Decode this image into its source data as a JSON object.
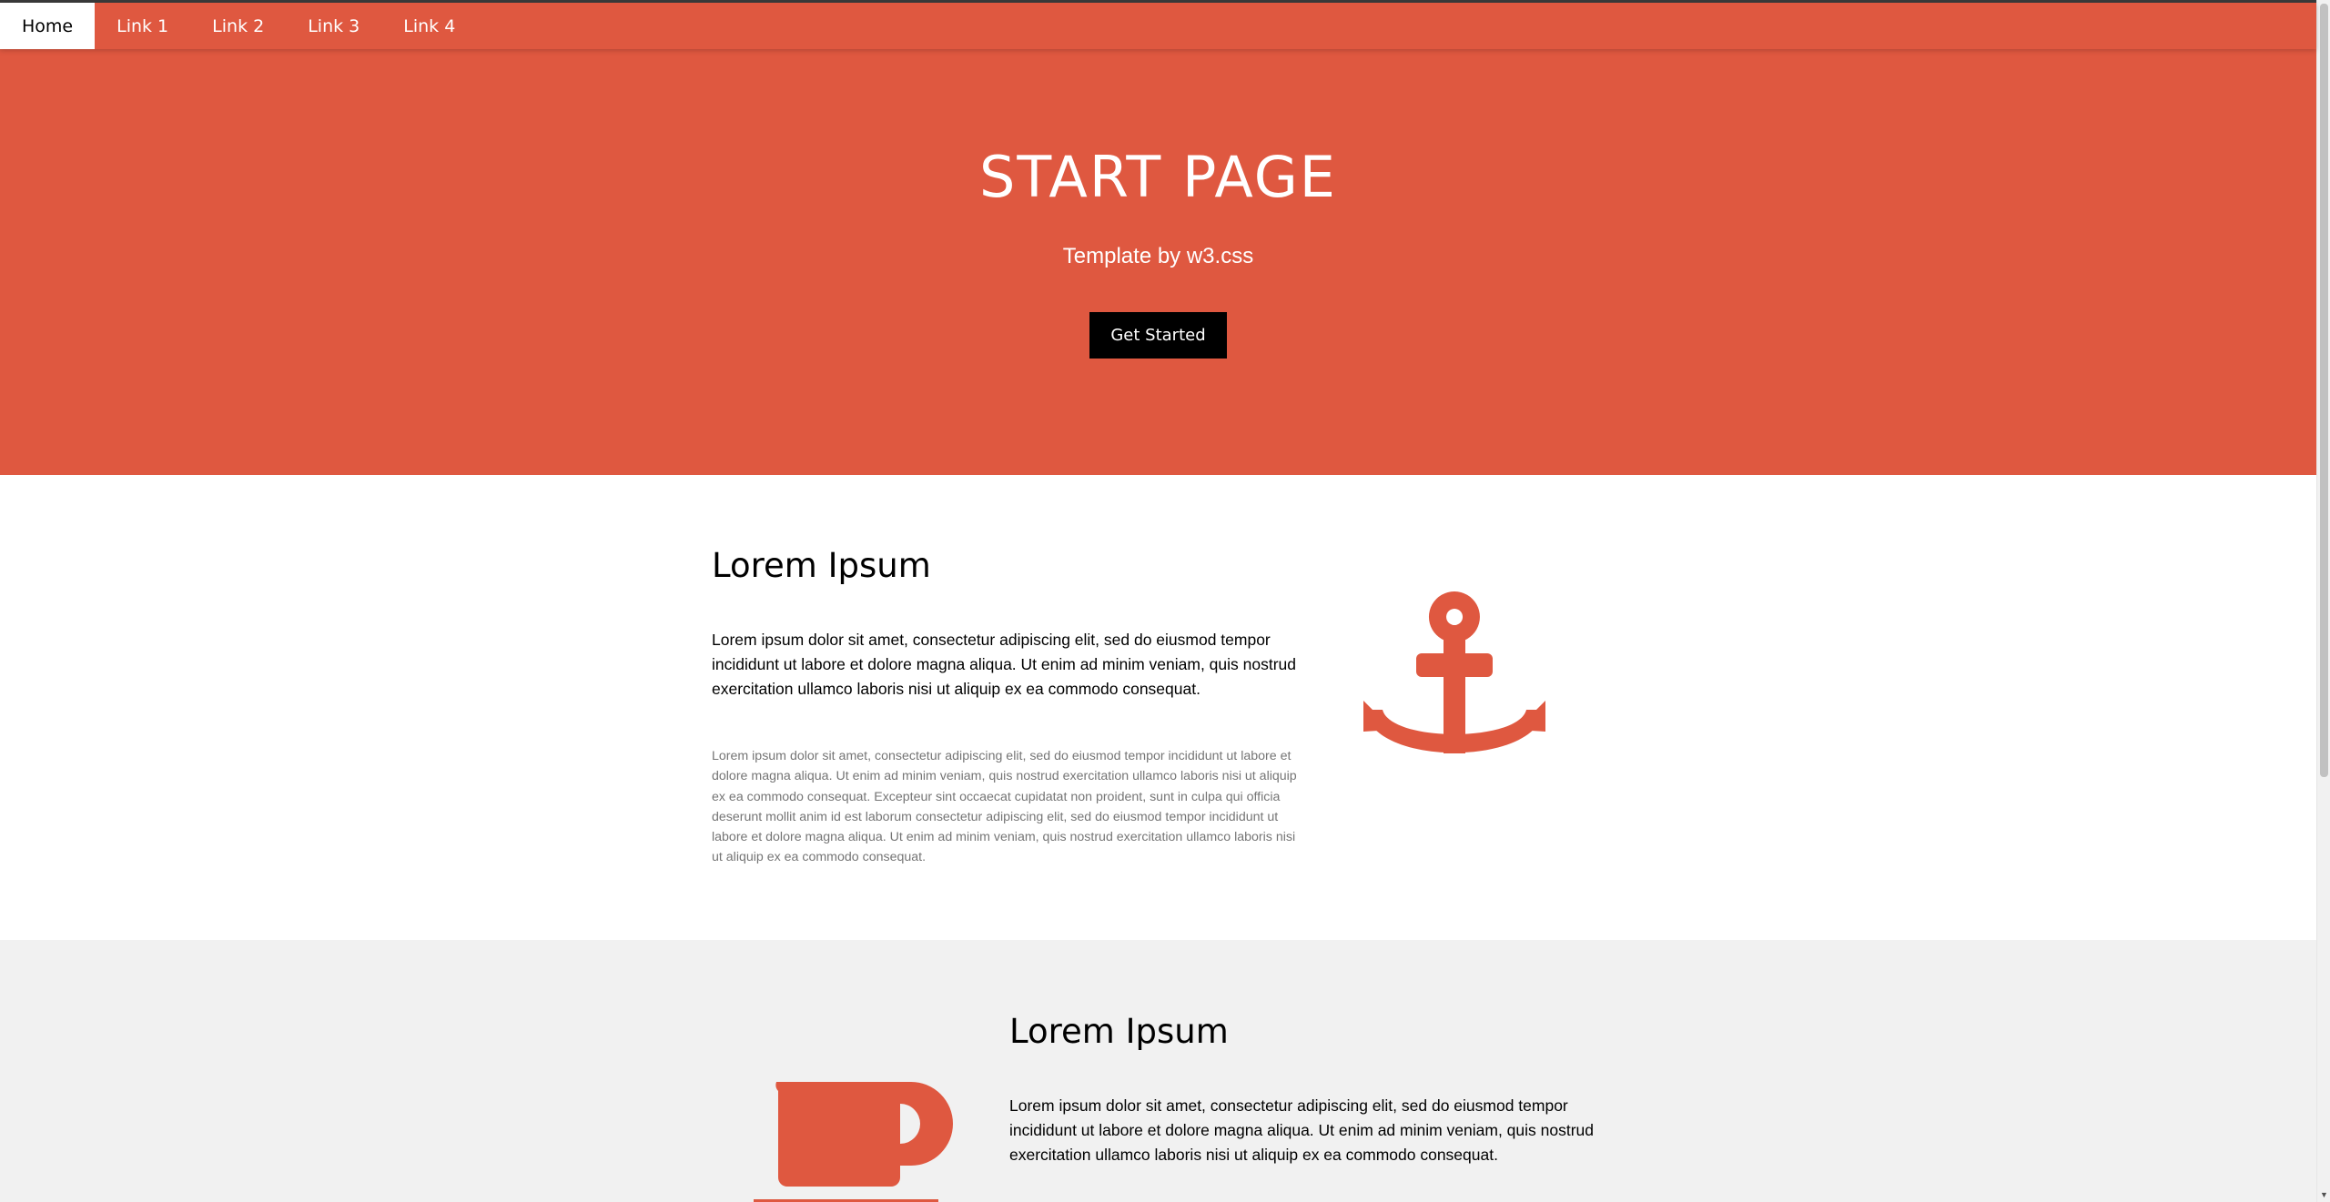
{
  "nav": {
    "items": [
      {
        "label": "Home",
        "active": true
      },
      {
        "label": "Link 1"
      },
      {
        "label": "Link 2"
      },
      {
        "label": "Link 3"
      },
      {
        "label": "Link 4"
      }
    ]
  },
  "hero": {
    "title": "START PAGE",
    "subtitle": "Template by w3.css",
    "button": "Get Started"
  },
  "section1": {
    "title": "Lorem Ipsum",
    "lead": "Lorem ipsum dolor sit amet, consectetur adipiscing elit, sed do eiusmod tempor incididunt ut labore et dolore magna aliqua. Ut enim ad minim veniam, quis nostrud exercitation ullamco laboris nisi ut aliquip ex ea commodo consequat.",
    "body": "Lorem ipsum dolor sit amet, consectetur adipiscing elit, sed do eiusmod tempor incididunt ut labore et dolore magna aliqua. Ut enim ad minim veniam, quis nostrud exercitation ullamco laboris nisi ut aliquip ex ea commodo consequat. Excepteur sint occaecat cupidatat non proident, sunt in culpa qui officia deserunt mollit anim id est laborum consectetur adipiscing elit, sed do eiusmod tempor incididunt ut labore et dolore magna aliqua. Ut enim ad minim veniam, quis nostrud exercitation ullamco laboris nisi ut aliquip ex ea commodo consequat.",
    "icon": "anchor-icon"
  },
  "section2": {
    "title": "Lorem Ipsum",
    "lead": "Lorem ipsum dolor sit amet, consectetur adipiscing elit, sed do eiusmod tempor incididunt ut labore et dolore magna aliqua. Ut enim ad minim veniam, quis nostrud exercitation ullamco laboris nisi ut aliquip ex ea commodo consequat.",
    "icon": "coffee-cup-icon"
  },
  "colors": {
    "accent": "#df5840",
    "section_alt": "#f1f1f1",
    "button": "#000000"
  }
}
